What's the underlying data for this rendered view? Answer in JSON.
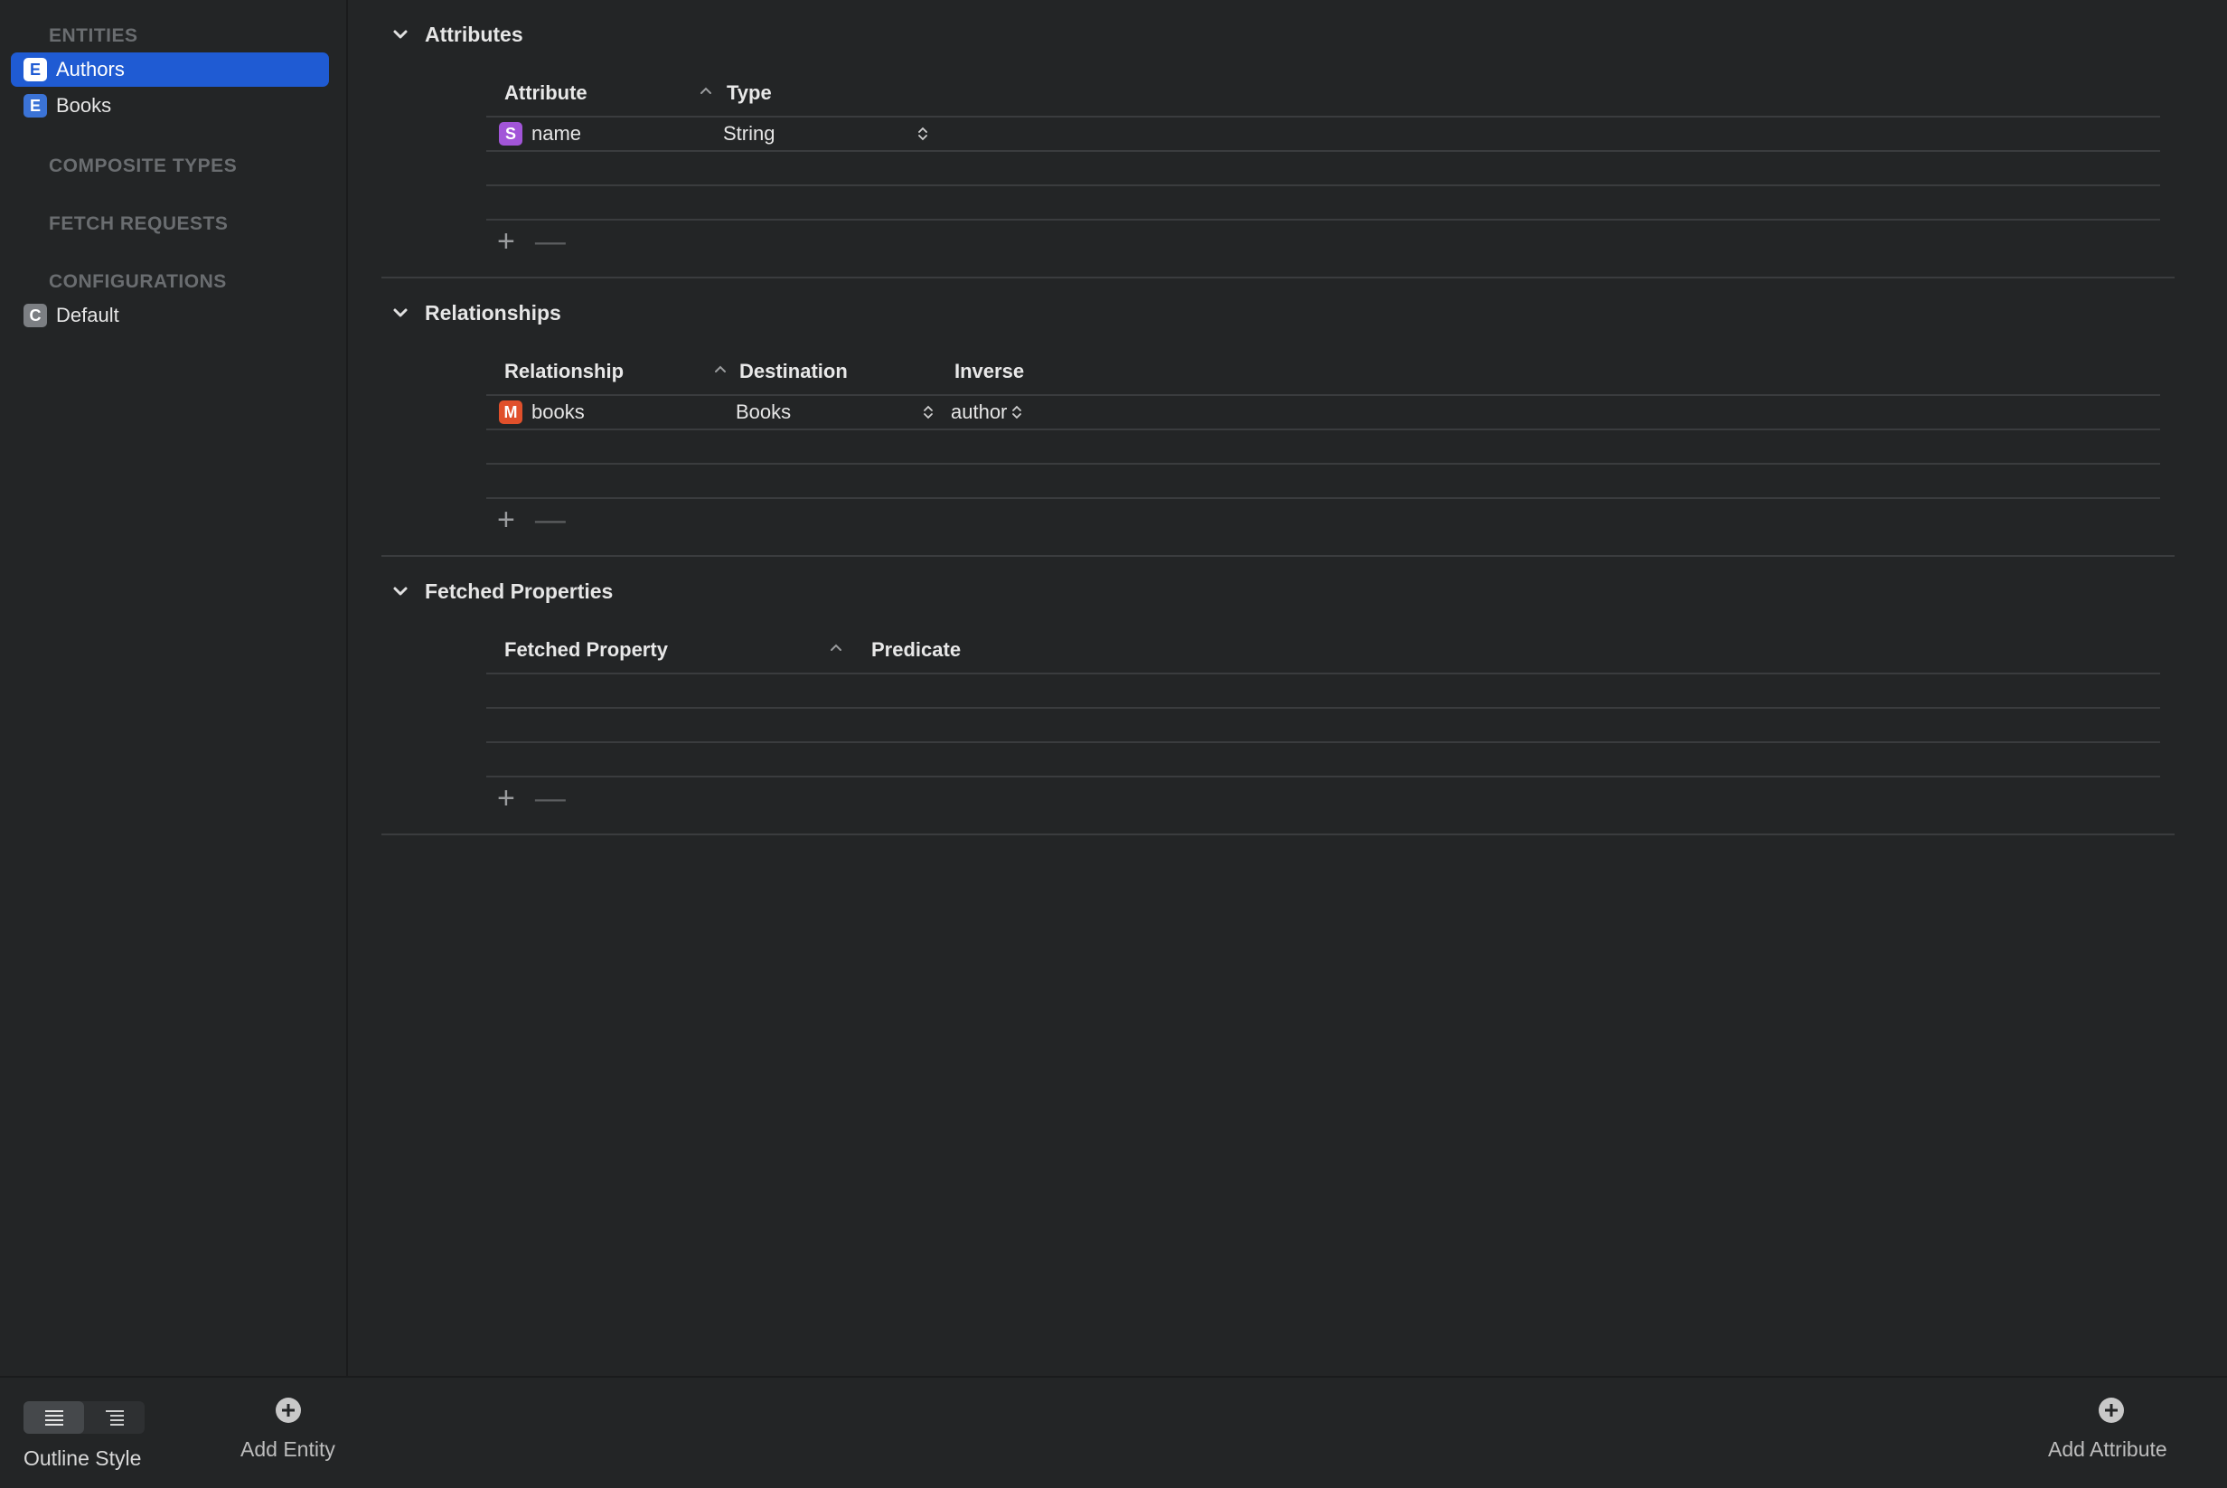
{
  "sidebar": {
    "entities_header": "ENTITIES",
    "entities": [
      {
        "badge": "E",
        "label": "Authors",
        "selected": true
      },
      {
        "badge": "E",
        "label": "Books",
        "selected": false
      }
    ],
    "composite_types_header": "COMPOSITE TYPES",
    "fetch_requests_header": "FETCH REQUESTS",
    "configurations_header": "CONFIGURATIONS",
    "configurations": [
      {
        "badge": "C",
        "label": "Default"
      }
    ]
  },
  "attributes": {
    "title": "Attributes",
    "col_attribute": "Attribute",
    "col_type": "Type",
    "rows": [
      {
        "badge": "S",
        "name": "name",
        "type": "String"
      }
    ]
  },
  "relationships": {
    "title": "Relationships",
    "col_relationship": "Relationship",
    "col_destination": "Destination",
    "col_inverse": "Inverse",
    "rows": [
      {
        "badge": "M",
        "name": "books",
        "destination": "Books",
        "inverse": "author"
      }
    ]
  },
  "fetched_properties": {
    "title": "Fetched Properties",
    "col_fetched_property": "Fetched Property",
    "col_predicate": "Predicate"
  },
  "bottom_bar": {
    "outline_style_label": "Outline Style",
    "add_entity_label": "Add Entity",
    "add_attribute_label": "Add Attribute"
  },
  "colors": {
    "background": "#232526",
    "selection": "#1f5bd3",
    "entity_badge": "#3b73d6",
    "string_badge": "#a255d8",
    "relationship_badge": "#e0502b"
  }
}
